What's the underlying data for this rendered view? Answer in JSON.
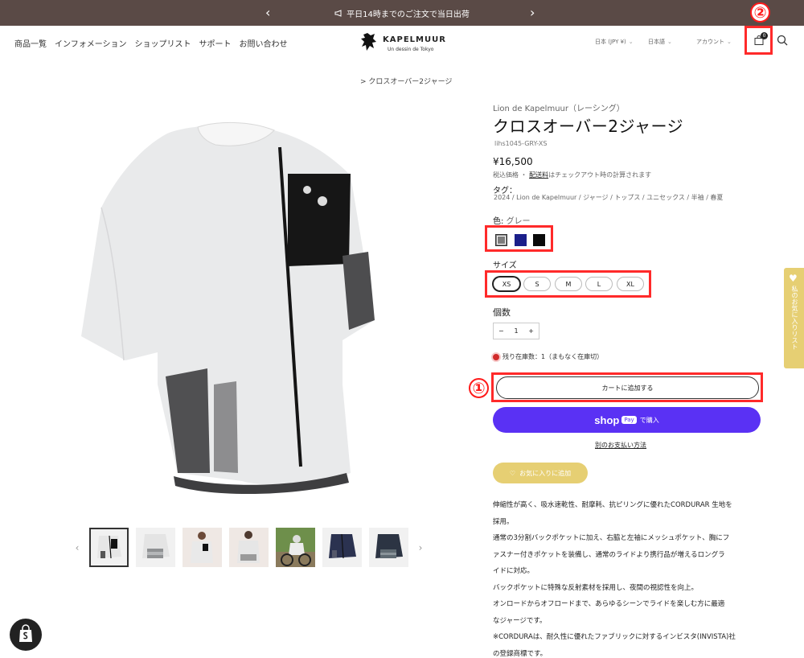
{
  "announcement": {
    "message": "平日14時までのご注文で当日出荷",
    "prev_icon": "chevron-left-icon",
    "next_icon": "chevron-right-icon"
  },
  "header": {
    "nav": [
      "商品一覧",
      "インフォメーション",
      "ショップリスト",
      "サポート",
      "お問い合わせ"
    ],
    "logo_brand": "KAPELMUUR",
    "logo_tagline": "Un dessin de Tokyo",
    "currency": "日本 (JPY ¥)",
    "language": "日本語",
    "account": "アカウント",
    "cart_count": "0",
    "annotation_two": "②"
  },
  "breadcrumb": "> クロスオーバー2ジャージ",
  "product": {
    "vendor": "Lion de Kapelmuur（レーシング）",
    "title": "クロスオーバー2ジャージ",
    "sku": "lihs1045-GRY-XS",
    "price": "¥16,500",
    "tax_note_prefix": "税込価格 ・",
    "tax_note_link": "配送料",
    "tax_note_suffix": "はチェックアウト時の計算されます",
    "tags_label": "タグ：",
    "tags": "2024 / Lion de Kapelmuur / ジャージ / トップス / ユニセックス / 半袖 / 春夏",
    "color_label": "色:",
    "color_value": "グレー",
    "colors": [
      "#7c7c7c",
      "#1b1f8a",
      "#0a0a0a"
    ],
    "size_label": "サイズ",
    "sizes": [
      "XS",
      "S",
      "M",
      "L",
      "XL"
    ],
    "selected_size": "XS",
    "qty_label": "個数",
    "qty_minus": "−",
    "qty_value": "1",
    "qty_plus": "+",
    "stock_text": "残り在庫数：1（まもなく在庫切）",
    "add_to_cart": "カートに追加する",
    "annotation_one": "①",
    "shoppay_word": "shop",
    "shoppay_pay": "Pay",
    "shoppay_buy": "で購入",
    "other_payment": "別のお支払い方法",
    "favorite": "お気に入りに追加",
    "description": [
      "伸縮性が高く、吸水速乾性、耐摩耗、抗ピリングに優れたCORDURAR 生地を",
      "採用。",
      "通常の3分割バックポケットに加え、右脇と左袖にメッシュポケット、胸にフ",
      "ァスナー付きポケットを装備し、通常のライドより携行品が増えるロングラ",
      "イドに対応。",
      "バックポケットに特殊な反射素材を採用し、夜間の視認性を向上。",
      "オンロードからオフロードまで、あらゆるシーンでライドを楽しむ方に最適",
      "なジャージです。",
      "※CORDURAは、耐久性に優れたファブリックに対するインビスタ(INVISTA)社",
      "の登録商標です。"
    ]
  },
  "side_tab": "私のお気に入りリスト",
  "accent_colors": {
    "highlight_red": "#ff2a2a",
    "shoppay_purple": "#5a31f4",
    "favorite_gold": "#e6cf73",
    "announce_bg": "#5a4a46"
  }
}
